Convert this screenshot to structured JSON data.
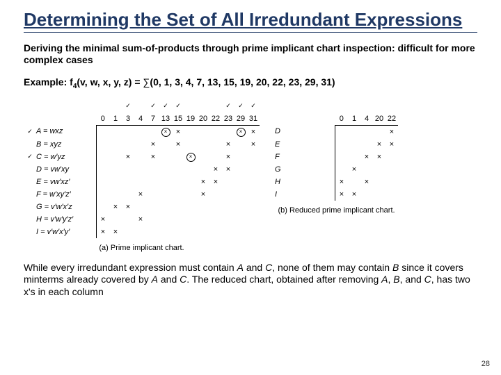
{
  "title": "Determining the Set of All Irredundant Expressions",
  "p1": "Deriving the minimal sum-of-products through prime implicant chart inspection: difficult for more complex cases",
  "example_prefix": "Example: f",
  "example_sub": "4",
  "example_args": "(v, w, x, y, z) = ",
  "sigma": "∑",
  "minterms": "(0, 1, 3, 4, 7, 13, 15, 19, 20, 22, 23, 29, 31)",
  "chart_data": [
    {
      "type": "table",
      "title": "(a) Prime implicant chart.",
      "col_ticks": {
        "3": "✓",
        "7": "✓",
        "13": "✓",
        "15": "✓",
        "23": "✓",
        "29": "✓",
        "31": "✓"
      },
      "columns": [
        "0",
        "1",
        "3",
        "4",
        "7",
        "13",
        "15",
        "19",
        "20",
        "22",
        "23",
        "29",
        "31"
      ],
      "rows": [
        {
          "tick": "✓",
          "label": "A = wxz",
          "marks": {
            "13": "⊗",
            "15": "×",
            "29": "⊗",
            "31": "×"
          }
        },
        {
          "tick": "",
          "label": "B = xyz",
          "marks": {
            "7": "×",
            "15": "×",
            "23": "×",
            "31": "×"
          }
        },
        {
          "tick": "✓",
          "label": "C = w′yz",
          "marks": {
            "3": "×",
            "7": "×",
            "19": "⊗",
            "23": "×"
          }
        },
        {
          "tick": "",
          "label": "D = vw′xy",
          "marks": {
            "22": "×",
            "23": "×"
          }
        },
        {
          "tick": "",
          "label": "E = vw′xz′",
          "marks": {
            "20": "×",
            "22": "×"
          }
        },
        {
          "tick": "",
          "label": "F = w′xy′z′",
          "marks": {
            "4": "×",
            "20": "×"
          }
        },
        {
          "tick": "",
          "label": "G = v′w′x′z",
          "marks": {
            "1": "×",
            "3": "×"
          }
        },
        {
          "tick": "",
          "label": "H = v′w′y′z′",
          "marks": {
            "0": "×",
            "4": "×"
          }
        },
        {
          "tick": "",
          "label": "I = v′w′x′y′",
          "marks": {
            "0": "×",
            "1": "×"
          }
        }
      ]
    },
    {
      "type": "table",
      "title": "(b) Reduced prime implicant chart.",
      "columns": [
        "0",
        "1",
        "4",
        "20",
        "22"
      ],
      "rows": [
        {
          "label": "D",
          "marks": {
            "22": "×"
          }
        },
        {
          "label": "E",
          "marks": {
            "20": "×",
            "22": "×"
          }
        },
        {
          "label": "F",
          "marks": {
            "4": "×",
            "20": "×"
          }
        },
        {
          "label": "G",
          "marks": {
            "1": "×"
          }
        },
        {
          "label": "H",
          "marks": {
            "0": "×",
            "4": "×"
          }
        },
        {
          "label": "I",
          "marks": {
            "0": "×",
            "1": "×"
          }
        }
      ]
    }
  ],
  "p2_a": "While every irredundant expression must contain ",
  "p2_b": " and ",
  "p2_c": ", none of them may contain ",
  "p2_d": " since it covers minterms already covered by ",
  "p2_e": ". The reduced chart, obtained after removing ",
  "p2_f": ", and ",
  "p2_g": ", has two x's in each column",
  "sym": {
    "A": "A",
    "B": "B",
    "C": "C"
  },
  "pagenum": "28"
}
